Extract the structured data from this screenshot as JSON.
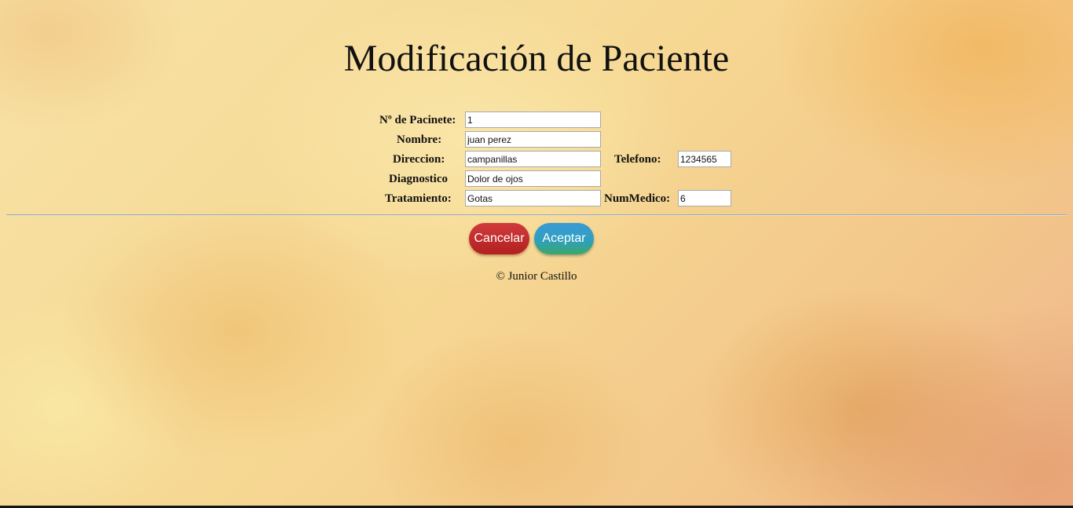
{
  "page": {
    "title": "Modificación de Paciente"
  },
  "form": {
    "patient_number": {
      "label": "Nº de Pacinete:",
      "value": "1"
    },
    "name": {
      "label": "Nombre:",
      "value": "juan perez"
    },
    "address": {
      "label": "Direccion:",
      "value": "campanillas"
    },
    "phone": {
      "label": "Telefono:",
      "value": "1234565"
    },
    "diagnosis": {
      "label": "Diagnostico",
      "value": "Dolor de ojos"
    },
    "treatment": {
      "label": "Tratamiento:",
      "value": "Gotas"
    },
    "doctor_number": {
      "label": "NumMedico:",
      "value": "6"
    }
  },
  "actions": {
    "cancel_label": "Cancelar",
    "accept_label": "Aceptar"
  },
  "footer": {
    "copyright": "© Junior Castillo"
  },
  "colors": {
    "cancel_button": "#c62b2b",
    "accept_button_top": "#3a9ad6",
    "accept_button_bottom": "#3aa86a"
  }
}
